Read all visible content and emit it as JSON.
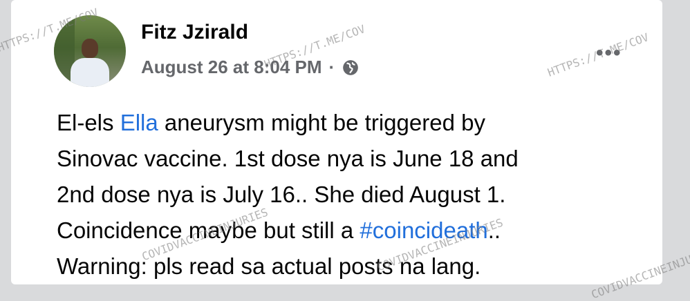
{
  "post": {
    "author": "Fitz Jzirald",
    "timestamp": "August 26 at 8:04 PM",
    "separator": "·",
    "privacy_icon": "globe-icon",
    "more_icon": "more-options-icon",
    "more_label": "•••",
    "lines": [
      [
        "El-els ",
        "Ella",
        " aneurysm might be triggered by"
      ],
      [
        "Sinovac vaccine. 1st dose nya is June 18 and"
      ],
      [
        "2nd dose nya is July 16.. She died August 1."
      ],
      [
        "Coincidence maybe but still a ",
        "#coincideath",
        ".."
      ],
      [
        "Warning: pls read sa actual posts na lang."
      ]
    ],
    "mention": "Ella",
    "hashtag": "#coincideath"
  },
  "watermarks": {
    "url_mark": "HTTPS://T.ME/COV",
    "text_mark": "COVIDVACCINEINJURIES"
  },
  "colors": {
    "link": "#216fdb",
    "text": "#050505",
    "meta": "#65676b",
    "background": "#d9dadc"
  }
}
